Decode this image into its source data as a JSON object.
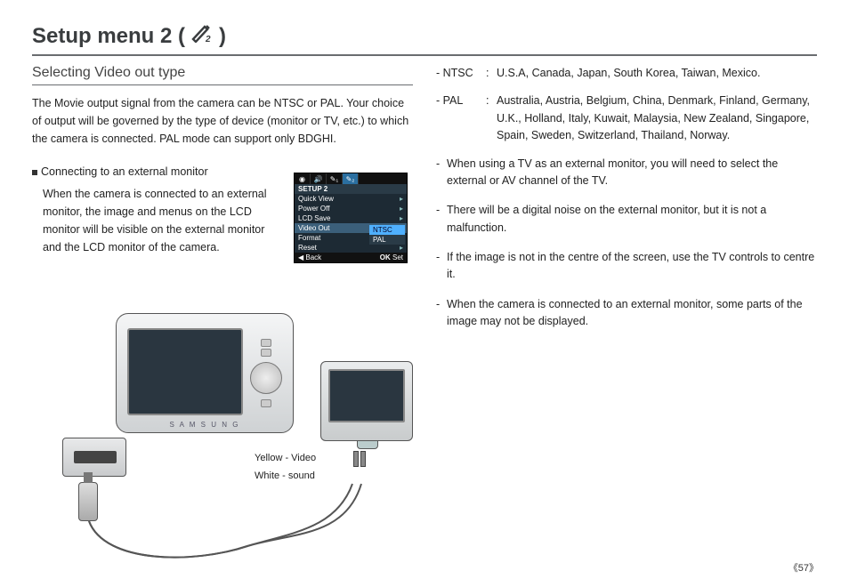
{
  "title": "Setup menu 2 (",
  "title_close": ")",
  "subhead": "Selecting Video out type",
  "lead": "The Movie output signal from the camera can be NTSC or PAL. Your choice of output will be governed by the type of device (monitor or TV, etc.) to which the camera is connected. PAL mode can support only BDGHI.",
  "bullet": "Connecting to an external monitor",
  "body_indent": "When the camera is connected to an external monitor, the image and menus on the LCD monitor will be visible on the external monitor and the LCD monitor of the camera.",
  "menu": {
    "head": "SETUP 2",
    "rows": [
      "Quick View",
      "Power Off",
      "LCD Save",
      "Video Out",
      "Format",
      "Reset"
    ],
    "opts": [
      "NTSC",
      "PAL"
    ],
    "foot_back_icon": "◀",
    "foot_back": "Back",
    "foot_ok": "OK",
    "foot_set": "Set"
  },
  "cable_labels": {
    "yellow": "Yellow - Video",
    "white": "White - sound"
  },
  "camera_brand": "S A M S U N G",
  "defs": [
    {
      "term": "- NTSC",
      "sep": ":",
      "body": "U.S.A, Canada, Japan, South Korea, Taiwan, Mexico."
    },
    {
      "term": "- PAL",
      "sep": ":",
      "body": "Australia, Austria, Belgium, China, Denmark, Finland, Germany, U.K., Holland, Italy, Kuwait, Malaysia, New Zealand, Singapore, Spain, Sweden, Switzerland, Thailand, Norway."
    }
  ],
  "notes": [
    "When using a TV as an external monitor, you will need to select the external or AV channel of the TV.",
    "There will be a digital noise on the external monitor, but it is not a malfunction.",
    "If the image is not in the centre of the screen, use the TV controls to centre it.",
    "When the camera is connected to an external monitor, some parts of the image may not be displayed."
  ],
  "pagenum": "《57》"
}
